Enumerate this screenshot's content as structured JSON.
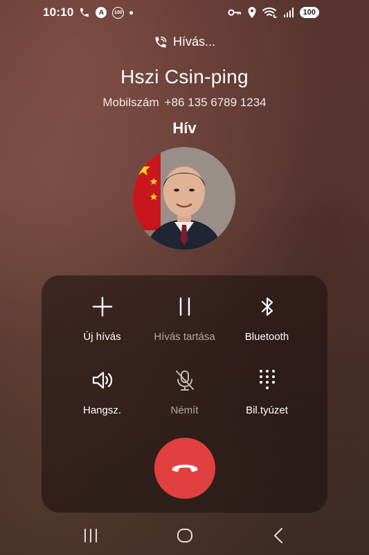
{
  "status_bar": {
    "time": "10:10",
    "left_icons": [
      "phone-call-icon",
      "auto-a-icon",
      "data-saver-100-icon",
      "notification-dot"
    ],
    "auto_badge": "A",
    "left_badge": "100",
    "right_icons": [
      "key-icon",
      "location-icon",
      "wifi-calling-icon",
      "signal-icon"
    ],
    "battery": "100"
  },
  "call": {
    "status": "Hívás...",
    "name": "Hszi Csin-ping",
    "number_type": "Mobilszám",
    "number": "+86 135 6789 1234",
    "state": "Hív"
  },
  "controls": [
    {
      "label": "Új hívás",
      "icon": "plus-icon",
      "enabled": true
    },
    {
      "label": "Hívás tartása",
      "icon": "pause-icon",
      "enabled": false
    },
    {
      "label": "Bluetooth",
      "icon": "bluetooth-icon",
      "enabled": true
    },
    {
      "label": "Hangsz.",
      "icon": "speaker-icon",
      "enabled": true
    },
    {
      "label": "Némít",
      "icon": "mic-off-icon",
      "enabled": false
    },
    {
      "label": "Bil.tyúzet",
      "icon": "keypad-icon",
      "enabled": true
    }
  ],
  "end_call": {
    "icon": "end-call-icon",
    "color": "#e2403f"
  },
  "navbar": {
    "icons": [
      "recents-icon",
      "home-icon",
      "back-icon"
    ]
  },
  "colors": {
    "panel": "#2a1c19",
    "end_call": "#e2403f",
    "disabled_text": "#b7a8a3"
  }
}
